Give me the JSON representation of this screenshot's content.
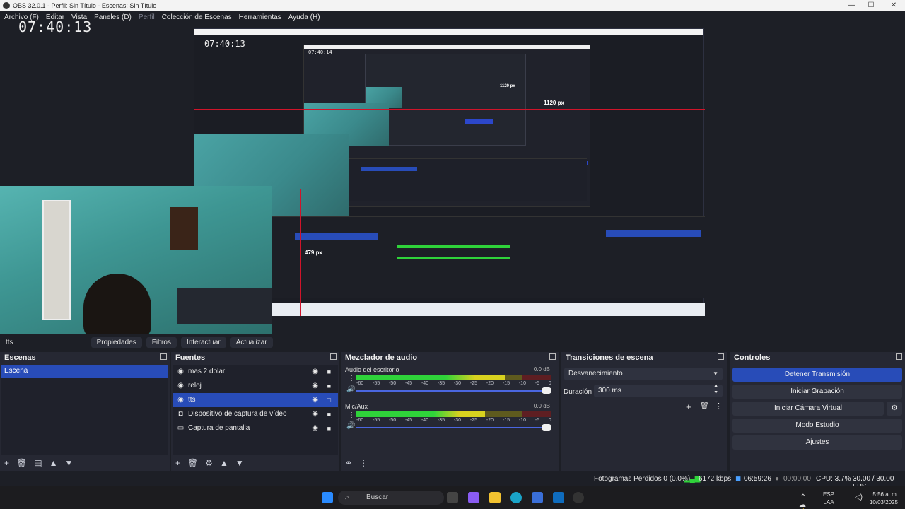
{
  "window": {
    "title": "OBS 32.0.1 - Perfil: Sin Título - Escenas: Sin Título",
    "minimize": "—",
    "maximize": "☐",
    "close": "✕"
  },
  "menu": {
    "items": [
      "Archivo (F)",
      "Editar",
      "Vista",
      "Paneles (D)",
      "Perfil",
      "Colección de Escenas",
      "Herramientas",
      "Ayuda (H)"
    ]
  },
  "preview": {
    "clock": "07:40:13",
    "nested_clock": "07:40:13",
    "nested_clock2": "07:40:14",
    "px_label_large": "1120 px",
    "px_label_small": "1120 px",
    "px_label_side": "479 px"
  },
  "source_toolbar": {
    "selected_source": "tts",
    "properties": "Propiedades",
    "filters": "Filtros",
    "interact": "Interactuar",
    "refresh": "Actualizar"
  },
  "scenes": {
    "title": "Escenas",
    "items": [
      {
        "label": "Escena",
        "selected": true
      }
    ]
  },
  "sources": {
    "title": "Fuentes",
    "items": [
      {
        "label": "mas 2 dolar",
        "icon": "globe-icon"
      },
      {
        "label": "reloj",
        "icon": "globe-icon"
      },
      {
        "label": "tts",
        "icon": "globe-icon",
        "selected": true
      },
      {
        "label": "Dispositivo de captura de vídeo",
        "icon": "camera-icon"
      },
      {
        "label": "Captura de pantalla",
        "icon": "monitor-icon"
      }
    ]
  },
  "mixer": {
    "title": "Mezclador de audio",
    "channels": [
      {
        "name": "Audio del escritorio",
        "db": "0.0 dB",
        "level_fraction": 0.76
      },
      {
        "name": "Mic/Aux",
        "db": "0.0 dB",
        "level_fraction": 0.66
      }
    ],
    "ticks": [
      "-60",
      "-55",
      "-50",
      "-45",
      "-40",
      "-35",
      "-30",
      "-25",
      "-20",
      "-15",
      "-10",
      "-5",
      "0"
    ]
  },
  "transitions": {
    "title": "Transiciones de escena",
    "selected": "Desvanecimiento",
    "duration_label": "Duración",
    "duration_value": "300 ms"
  },
  "controls": {
    "title": "Controles",
    "stop_streaming": "Detener Transmisión",
    "start_recording": "Iniciar Grabación",
    "start_virtual_cam": "Iniciar Cámara Virtual",
    "studio_mode": "Modo Estudio",
    "settings": "Ajustes"
  },
  "status": {
    "dropped_frames": "Fotogramas Perdidos 0 (0.0%)",
    "bitrate": "6172 kbps",
    "stream_time": "06:59:26",
    "record_time": "00:00:00",
    "cpu": "CPU: 3.7%",
    "fps": "30.00 / 30.00 FPS"
  },
  "taskbar": {
    "search_placeholder": "Buscar",
    "lang_top": "ESP",
    "lang_bottom": "LAA",
    "time": "5:56 a. m.",
    "date": "10/03/2025"
  },
  "colors": {
    "accent": "#284cb8",
    "panel": "#262833",
    "meter_green": "#2fd33a",
    "meter_yellow": "#d8d21f",
    "meter_red": "#c8202c",
    "guide_red": "#d0142a"
  }
}
